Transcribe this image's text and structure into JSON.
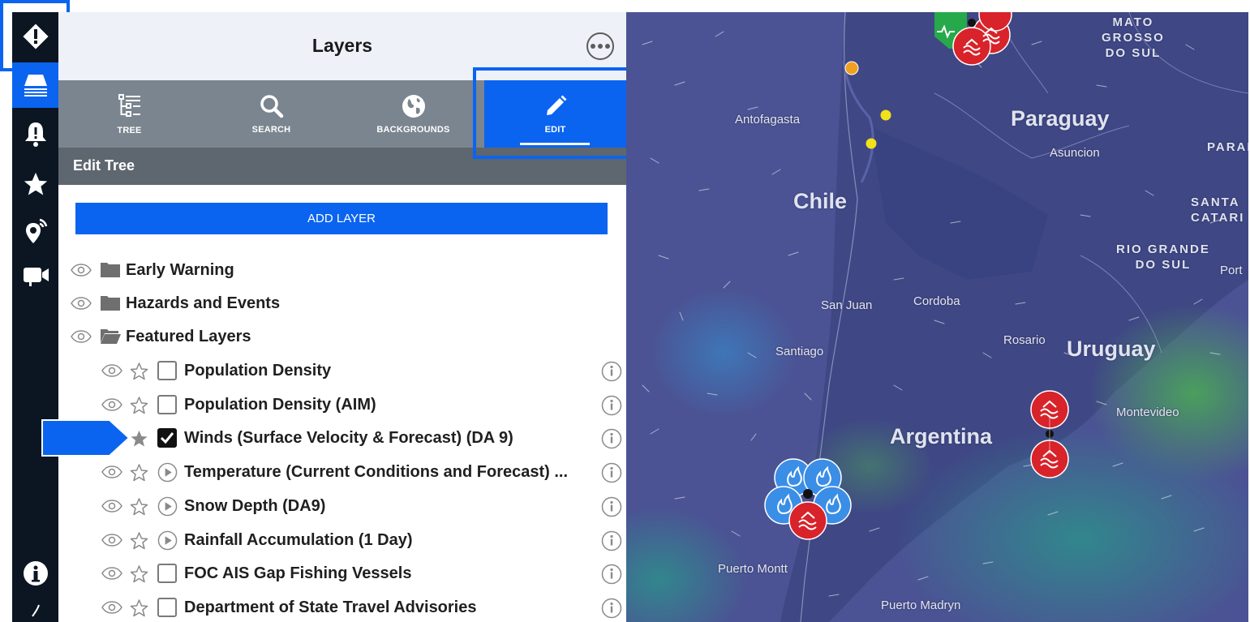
{
  "rail": {
    "items": [
      {
        "name": "warning-diamond-icon"
      },
      {
        "name": "layers-icon"
      },
      {
        "name": "alert-bell-icon"
      },
      {
        "name": "star-icon"
      },
      {
        "name": "location-signal-icon"
      },
      {
        "name": "video-camera-icon"
      },
      {
        "name": "info-icon"
      }
    ]
  },
  "panel": {
    "title": "Layers",
    "tabs": [
      {
        "label": "TREE",
        "icon": "tree-icon"
      },
      {
        "label": "SEARCH",
        "icon": "search-icon"
      },
      {
        "label": "BACKGROUNDS",
        "icon": "globe-icon"
      },
      {
        "label": "EDIT",
        "icon": "pencil-icon",
        "active": true
      }
    ],
    "section_title": "Edit Tree",
    "add_layer_label": "ADD LAYER",
    "folders": [
      {
        "label": "Early Warning",
        "open": false
      },
      {
        "label": "Hazards and Events",
        "open": false
      },
      {
        "label": "Featured Layers",
        "open": true
      }
    ],
    "layers": [
      {
        "label": "Population Density",
        "control": "checkbox",
        "checked": false,
        "favorite": false
      },
      {
        "label": "Population Density (AIM)",
        "control": "checkbox",
        "checked": false,
        "favorite": false
      },
      {
        "label": "Winds (Surface Velocity & Forecast) (DA 9)",
        "control": "checkbox",
        "checked": true,
        "favorite": true
      },
      {
        "label": "Temperature (Current Conditions and Forecast) ...",
        "control": "play",
        "checked": false,
        "favorite": false
      },
      {
        "label": "Snow Depth (DA9)",
        "control": "play",
        "checked": false,
        "favorite": false
      },
      {
        "label": "Rainfall Accumulation (1 Day)",
        "control": "play",
        "checked": false,
        "favorite": false
      },
      {
        "label": "FOC AIS Gap Fishing Vessels",
        "control": "checkbox",
        "checked": false,
        "favorite": false
      },
      {
        "label": "Department of State Travel Advisories",
        "control": "checkbox",
        "checked": false,
        "favorite": false
      }
    ]
  },
  "map": {
    "countries": [
      "Paraguay",
      "Chile",
      "Argentina",
      "Uruguay"
    ],
    "cities": [
      "Antofagasta",
      "Asuncion",
      "San Juan",
      "Cordoba",
      "Santiago",
      "Rosario",
      "Montevideo",
      "Puerto Montt",
      "Puerto Madryn",
      "Port"
    ],
    "regions": [
      "MATO\nGROSSO\nDO SUL",
      "PARANÁ",
      "SANTA\nCATARI",
      "RIO GRANDE\nDO SUL"
    ],
    "colors": {
      "base": "#4b5394",
      "land_dark": "#3d4480",
      "wind_green": "#4aa35a",
      "flood_marker": "#d8232a",
      "fire_marker": "#3a8ee6",
      "yellow_dot": "#f2e11b",
      "orange_dot": "#f0a020"
    }
  }
}
